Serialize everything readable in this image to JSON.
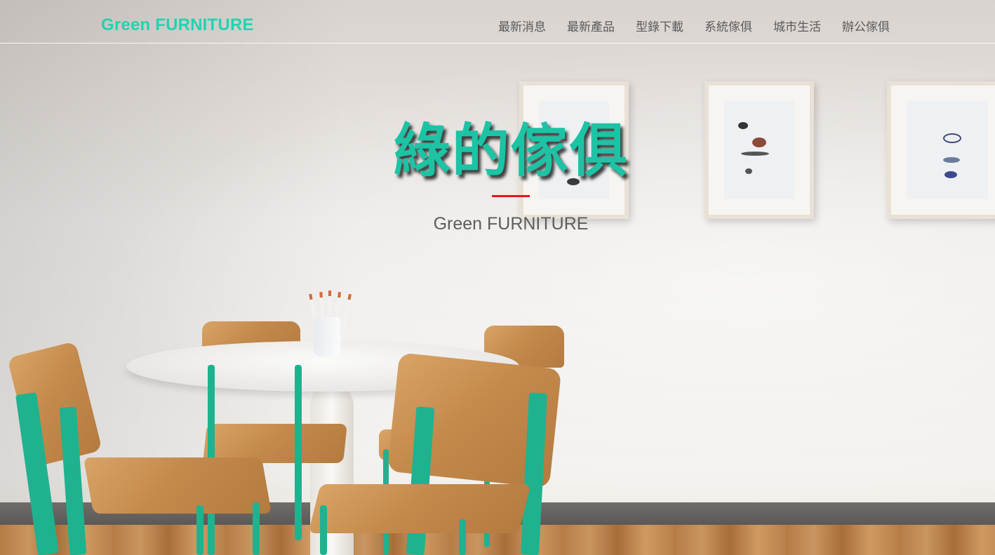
{
  "header": {
    "brand": "Green FURNITURE",
    "nav": [
      {
        "label": "最新消息"
      },
      {
        "label": "最新產品"
      },
      {
        "label": "型錄下載"
      },
      {
        "label": "系統傢俱"
      },
      {
        "label": "城市生活"
      },
      {
        "label": "辦公傢俱"
      }
    ]
  },
  "hero": {
    "title": "綠的傢俱",
    "subtitle": "Green FURNITURE"
  },
  "colors": {
    "brand": "#22d3b0",
    "title": "#1cc3a4",
    "accent_divider": "#e8141a",
    "nav_text": "#5b5b5b"
  }
}
